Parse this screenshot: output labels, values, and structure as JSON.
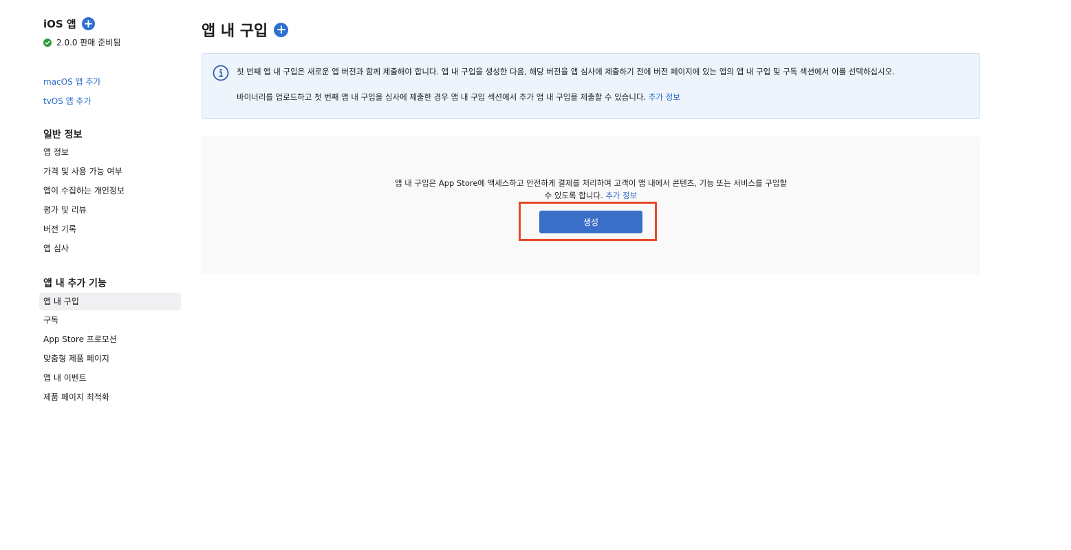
{
  "sidebar": {
    "app_title": "iOS 앱",
    "status": "2.0.0 판매 준비됨",
    "add_links": [
      "macOS 앱 추가",
      "tvOS 앱 추가"
    ],
    "general_heading": "일반 정보",
    "general_items": [
      "앱 정보",
      "가격 및 사용 가능 여부",
      "앱이 수집하는 개인정보",
      "평가 및 리뷰",
      "버전 기록",
      "앱 심사"
    ],
    "features_heading": "앱 내 추가 기능",
    "features_items": [
      "앱 내 구입",
      "구독",
      "App Store 프로모션",
      "맞춤형 제품 페이지",
      "앱 내 이벤트",
      "제품 페이지 최적화"
    ],
    "active_item": "앱 내 구입"
  },
  "main": {
    "title": "앱 내 구입",
    "info": {
      "line1": "첫 번째 앱 내 구입은 새로운 앱 버전과 함께 제출해야 합니다. 앱 내 구입을 생성한 다음, 해당 버전을 앱 심사에 제출하기 전에 버전 페이지에 있는 앱의 앱 내 구입 및 구독 섹션에서 이를 선택하십시오.",
      "line2": "바이너리를 업로드하고 첫 번째 앱 내 구입을 심사에 제출한 경우 앱 내 구입 섹션에서 추가 앱 내 구입을 제출할 수 있습니다.",
      "line2_link": "추가 정보"
    },
    "empty": {
      "line1": "앱 내 구입은 App Store에 액세스하고 안전하게 결제를 처리하여 고객이 앱 내에서 콘텐츠, 기능 또는 서비스를 구입할",
      "line2": "수 있도록 합니다.",
      "link": "추가 정보",
      "create_button": "생성"
    }
  },
  "colors": {
    "accent": "#2f6fd0",
    "link": "#2a6ac9",
    "highlight": "#e8472a",
    "success": "#2d9a3a",
    "info_bg": "#eef4fc"
  }
}
